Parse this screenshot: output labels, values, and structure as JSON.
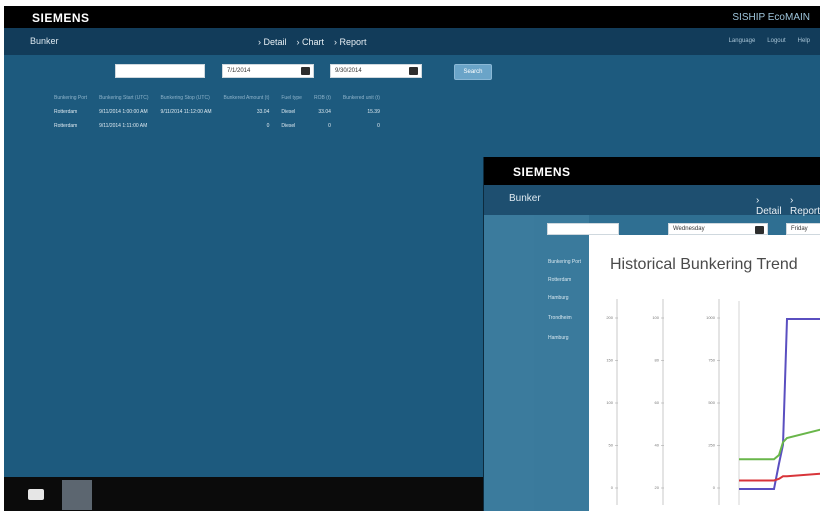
{
  "back": {
    "brand": "SIEMENS",
    "app": "SISHIP EcoMAIN",
    "nav_title": "Bunker",
    "nav_links": [
      "Detail",
      "Chart",
      "Report"
    ],
    "nav_right": [
      "Language",
      "Logout",
      "Help"
    ],
    "filter": {
      "field1_value": "",
      "date_from": "7/1/2014",
      "date_to": "9/30/2014",
      "search_label": "Search"
    },
    "table": {
      "headers": [
        "Bunkering Port",
        "Bunkering Start (UTC)",
        "Bunkering Stop (UTC)",
        "Bunkered Amount (t)",
        "Fuel type",
        "ROB (t)",
        "Bunkered unit (t)"
      ],
      "rows": [
        [
          "Rotterdam",
          "9/11/2014 1:00:00 AM",
          "9/11/2014 11:12:00 AM",
          "33.04",
          "Diesel",
          "33.04",
          "15.39"
        ],
        [
          "Rotterdam",
          "9/11/2014 1:11:00 AM",
          "",
          "0",
          "Diesel",
          "0",
          "0"
        ]
      ]
    }
  },
  "front": {
    "brand": "SIEMENS",
    "nav_title": "Bunker",
    "nav_links": [
      "Detail",
      "Report"
    ],
    "filter_date": "Wednesday",
    "filter_date2": "Friday",
    "side_rows": [
      "Bunkering Port",
      "Rotterdam",
      "Hamburg",
      "Trondheim",
      "Hamburg"
    ],
    "chart_title": "Historical Bunkering Trend"
  },
  "chart_data": {
    "type": "line",
    "title": "Historical Bunkering Trend",
    "axes": [
      {
        "ticks": [
          "0",
          "50",
          "100",
          "150",
          "200"
        ]
      },
      {
        "ticks": [
          "20",
          "40",
          "60",
          "80",
          "100"
        ]
      },
      {
        "ticks": [
          "0",
          "250",
          "500",
          "750",
          "1000"
        ]
      }
    ],
    "series": [
      {
        "color": "#5a4fc0",
        "values": [
          0,
          0,
          0,
          150,
          260,
          1000,
          1000
        ]
      },
      {
        "color": "#69b64a",
        "values": [
          35,
          35,
          35,
          40,
          55,
          60,
          70
        ]
      },
      {
        "color": "#d8353a",
        "values": [
          10,
          10,
          10,
          12,
          15,
          15,
          18
        ]
      }
    ]
  },
  "taskbar": {
    "icon": "window-switch-icon"
  }
}
